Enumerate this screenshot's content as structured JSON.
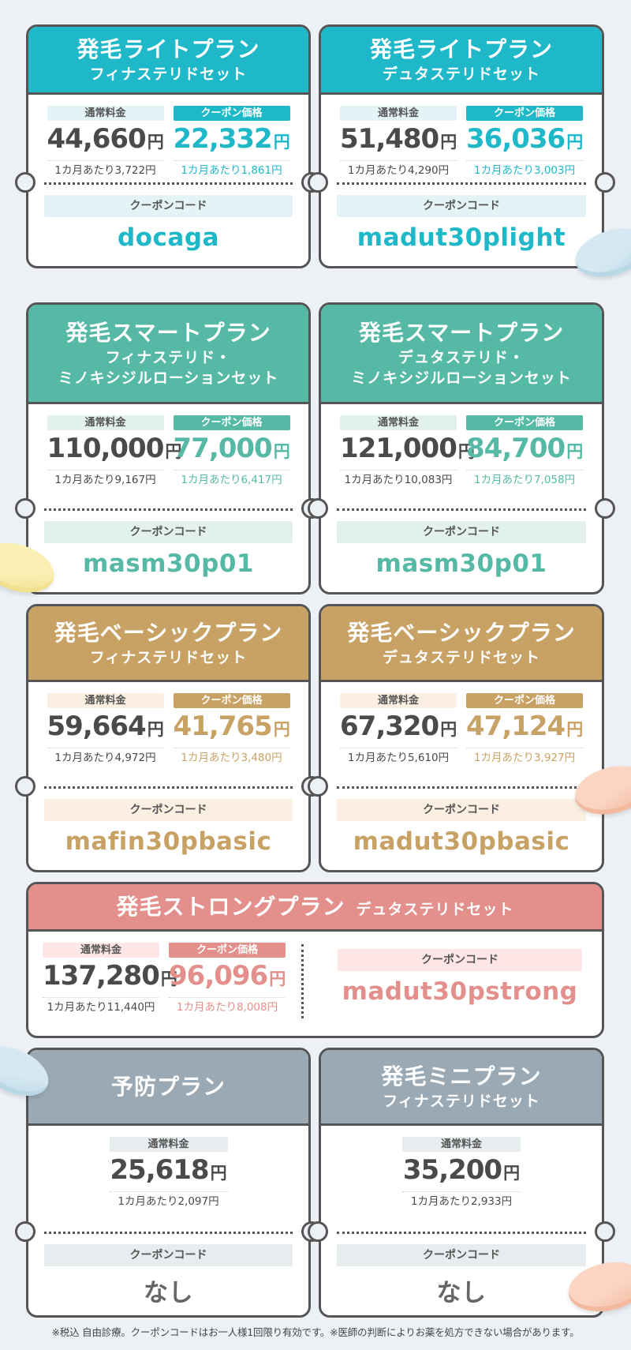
{
  "colors": {
    "blue": "#1fb8c9",
    "blue_light": "#e3f3f6",
    "green": "#56b9a5",
    "green_light": "#e3f1ee",
    "gold": "#c8a265",
    "gold_light": "#fbefe1",
    "pink": "#e38f8c",
    "pink_light": "#fde6e5",
    "gray": "#9aa9b4",
    "gray_light": "#e7ecef"
  },
  "labels": {
    "normal": "通常料金",
    "coupon_price": "クーポン価格",
    "coupon_code": "クーポンコード",
    "yen": "円"
  },
  "plans": [
    {
      "title": "発毛ライトプラン",
      "subtitle": "フィナステリドセット",
      "normal": "44,660",
      "normal_month": "1カ月あたり3,722円",
      "coupon": "22,332",
      "coupon_month": "1カ月あたり1,861円",
      "code": "docaga"
    },
    {
      "title": "発毛ライトプラン",
      "subtitle": "デュタステリドセット",
      "normal": "51,480",
      "normal_month": "1カ月あたり4,290円",
      "coupon": "36,036",
      "coupon_month": "1カ月あたり3,003円",
      "code": "madut30plight"
    },
    {
      "title": "発毛スマートプラン",
      "subtitle": "フィナステリド・",
      "subtitle2": "ミノキシジルローションセット",
      "normal": "110,000",
      "normal_month": "1カ月あたり9,167円",
      "coupon": "77,000",
      "coupon_month": "1カ月あたり6,417円",
      "code": "masm30p01"
    },
    {
      "title": "発毛スマートプラン",
      "subtitle": "デュタステリド・",
      "subtitle2": "ミノキシジルローションセット",
      "normal": "121,000",
      "normal_month": "1カ月あたり10,083円",
      "coupon": "84,700",
      "coupon_month": "1カ月あたり7,058円",
      "code": "masm30p01"
    },
    {
      "title": "発毛ベーシックプラン",
      "subtitle": "フィナステリドセット",
      "normal": "59,664",
      "normal_month": "1カ月あたり4,972円",
      "coupon": "41,765",
      "coupon_month": "1カ月あたり3,480円",
      "code": "mafin30pbasic"
    },
    {
      "title": "発毛ベーシックプラン",
      "subtitle": "デュタステリドセット",
      "normal": "67,320",
      "normal_month": "1カ月あたり5,610円",
      "coupon": "47,124",
      "coupon_month": "1カ月あたり3,927円",
      "code": "madut30pbasic"
    },
    {
      "title": "発毛ストロングプラン",
      "subtitle": "デュタステリドセット",
      "normal": "137,280",
      "normal_month": "1カ月あたり11,440円",
      "coupon": "96,096",
      "coupon_month": "1カ月あたり8,008円",
      "code": "madut30pstrong"
    },
    {
      "title": "予防プラン",
      "normal": "25,618",
      "normal_month": "1カ月あたり2,097円",
      "code": "なし"
    },
    {
      "title": "発毛ミニプラン",
      "subtitle": "フィナステリドセット",
      "normal": "35,200",
      "normal_month": "1カ月あたり2,933円",
      "code": "なし"
    }
  ],
  "footnote": "※税込 自由診療。クーポンコードはお一人様1回限り有効です。※医師の判断によりお薬を処方できない場合があります。"
}
